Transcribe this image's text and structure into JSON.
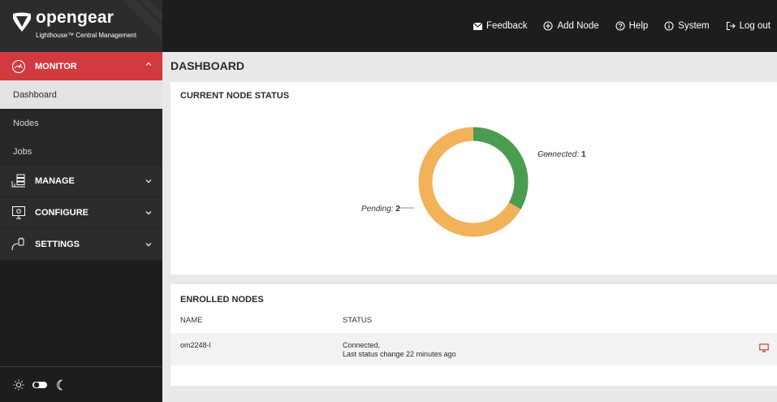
{
  "brand": {
    "name": "opengear",
    "subtitle": "Lighthouse™ Central Management"
  },
  "topnav": {
    "feedback": "Feedback",
    "add_node": "Add Node",
    "help": "Help",
    "system": "System",
    "logout": "Log out"
  },
  "sidebar": {
    "monitor": {
      "label": "MONITOR",
      "items": [
        "Dashboard",
        "Nodes",
        "Jobs"
      ]
    },
    "manage": "MANAGE",
    "configure": "CONFIGURE",
    "settings": "SETTINGS"
  },
  "page": {
    "title": "DASHBOARD"
  },
  "node_status": {
    "title": "CURRENT NODE STATUS",
    "connected_label": "Connected:",
    "connected_count": "1",
    "pending_label": "Pending:",
    "pending_count": "2"
  },
  "chart_data": {
    "type": "pie",
    "style": "donut",
    "categories": [
      "Connected",
      "Pending"
    ],
    "values": [
      1,
      2
    ],
    "colors": [
      "#4b9b50",
      "#f2b25a"
    ]
  },
  "enrolled": {
    "title": "ENROLLED NODES",
    "columns": [
      "NAME",
      "STATUS"
    ],
    "rows": [
      {
        "name": "om2248-l",
        "status": "Connected,",
        "status_detail": "Last status change 22 minutes ago"
      }
    ]
  },
  "colors": {
    "accent": "#d13a3e",
    "sidebar": "#1c1d1f",
    "connected": "#4b9b50",
    "pending": "#f2b25a"
  }
}
